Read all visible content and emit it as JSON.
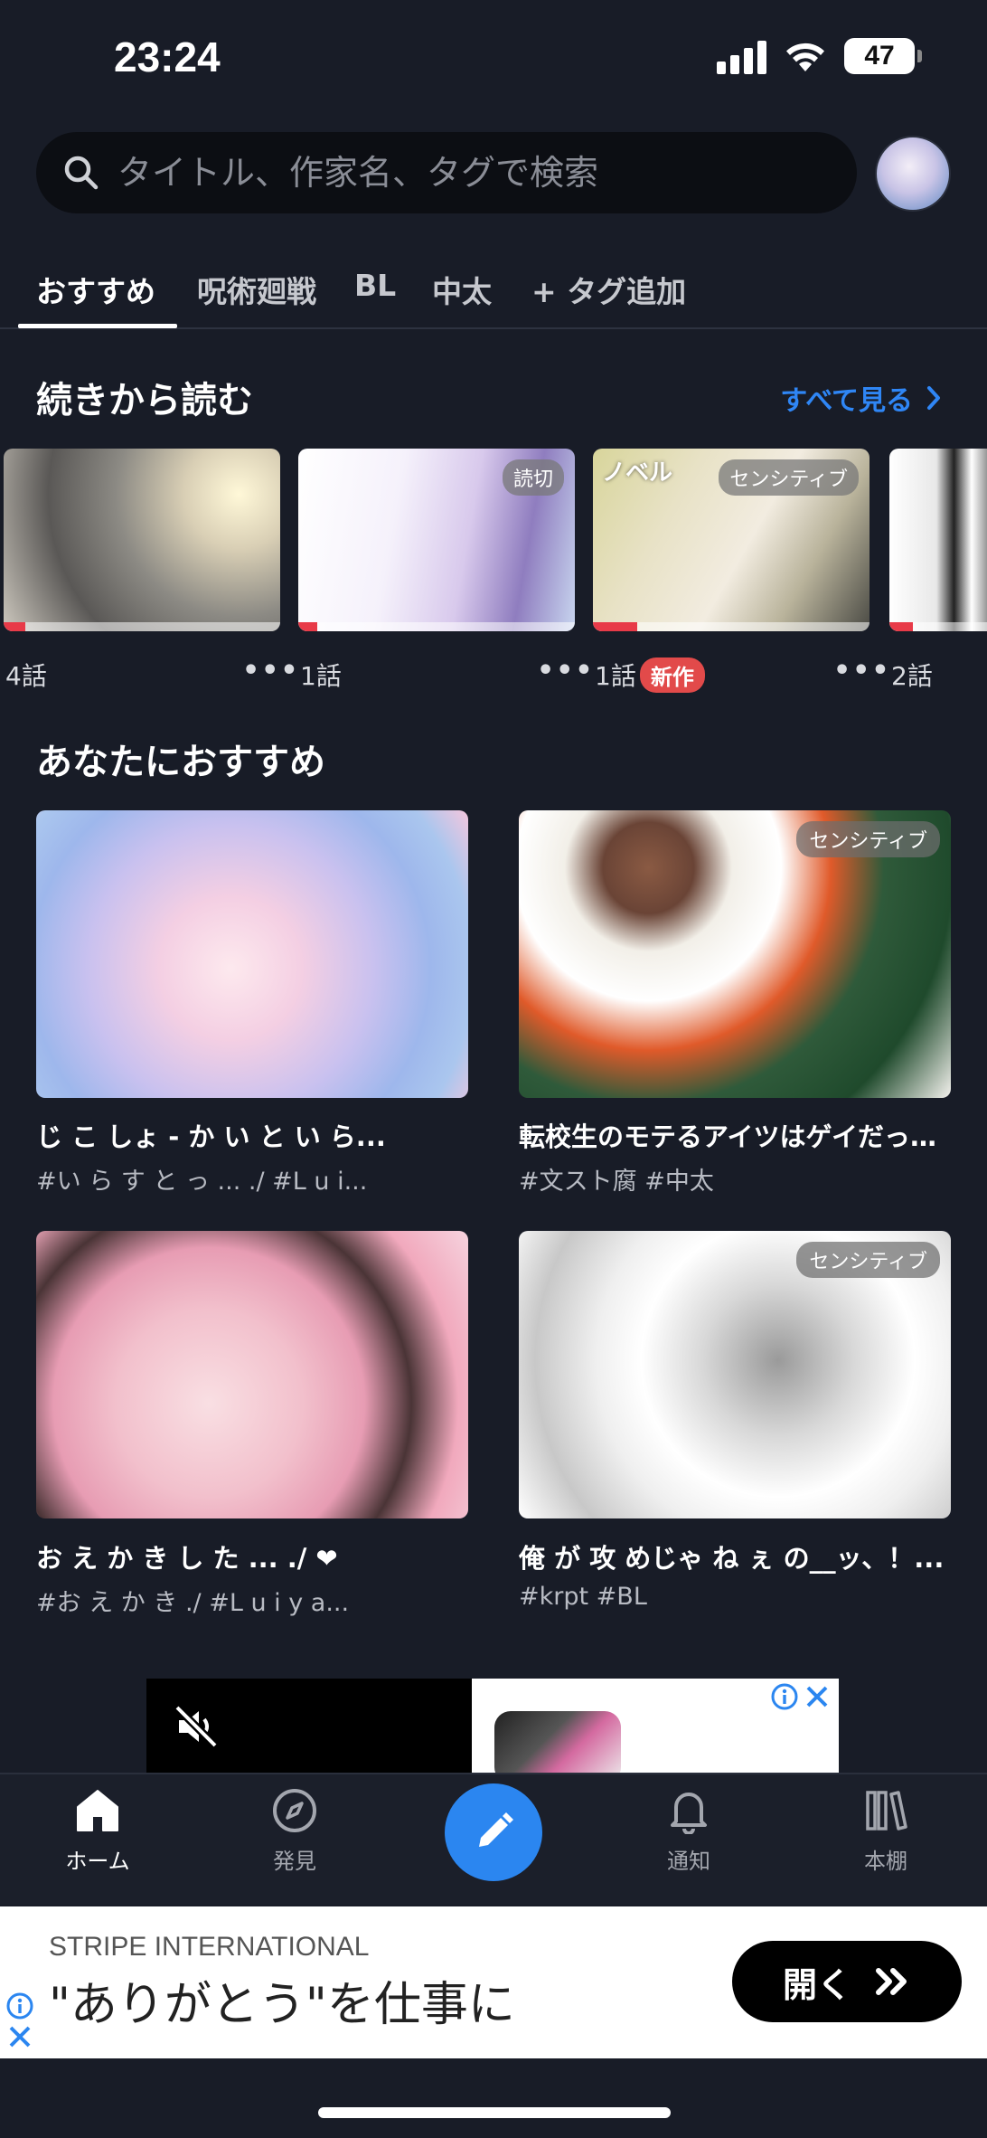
{
  "status_bar": {
    "time": "23:24",
    "battery": "47"
  },
  "search": {
    "placeholder": "タイトル、作家名、タグで検索"
  },
  "tabs": [
    {
      "label": "おすすめ",
      "active": true
    },
    {
      "label": "呪術廻戦"
    },
    {
      "label": "BL"
    },
    {
      "label": "中太"
    },
    {
      "label": "+ タグ追加"
    }
  ],
  "continue_section": {
    "title": "続きから読む",
    "see_all": "すべて見る",
    "items": [
      {
        "episodes": "4話",
        "progress": 0.08
      },
      {
        "episodes": "1話",
        "badge": "読切",
        "progress": 0.07
      },
      {
        "episodes": "1話",
        "badge_left": "ノベル",
        "badge": "センシティブ",
        "new_label": "新作",
        "progress": 0.16
      },
      {
        "episodes": "2話",
        "progress": 0.2
      }
    ]
  },
  "recommended_section": {
    "title": "あなたにおすすめ",
    "items": [
      {
        "title": "じ こ しょ - か い と い ら...",
        "tags": "#い ら す と っ ... ./  #L u i..."
      },
      {
        "title": "転校生のモテるアイツはゲイだっ…",
        "tags": "#文スト腐  #中太",
        "badge": "センシティブ"
      },
      {
        "title": "お え か き し た ... ./ ❤",
        "tags": "#お え か き ./  #L u i y a..."
      },
      {
        "title": "俺 が 攻 めじゃ ね ぇ の__ッ、！...",
        "tags": "#krpt  #BL",
        "badge": "センシティブ"
      }
    ]
  },
  "bottom_nav": {
    "home": "ホーム",
    "discover": "発見",
    "notifications": "通知",
    "bookshelf": "本棚"
  },
  "banner_ad": {
    "sponsor": "STRIPE INTERNATIONAL",
    "headline": "\"ありがとう\"を仕事に",
    "cta": "開く"
  },
  "colors": {
    "background": "#181c27",
    "accent": "#2f86f5",
    "new_badge": "#e24a4a",
    "progress": "#e83a48"
  }
}
